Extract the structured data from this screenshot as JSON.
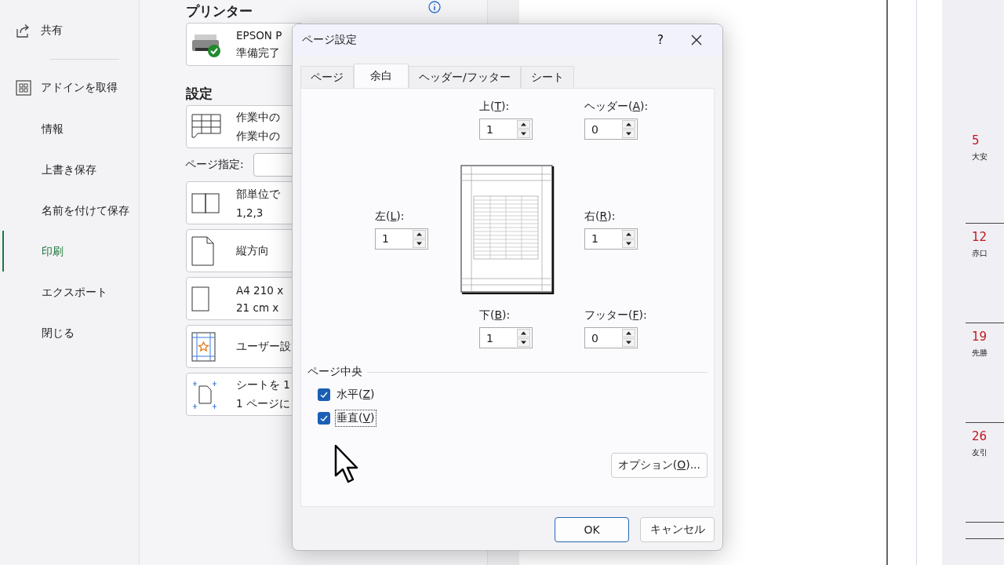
{
  "sidebar": {
    "top_items": [
      {
        "label": "共有",
        "selected": false
      },
      {
        "label": "アドインを取得",
        "selected": false
      }
    ],
    "items": [
      {
        "label": "情報",
        "selected": false
      },
      {
        "label": "上書き保存",
        "selected": false
      },
      {
        "label": "名前を付けて保存",
        "selected": false
      },
      {
        "label": "印刷",
        "selected": true
      },
      {
        "label": "エクスポート",
        "selected": false
      },
      {
        "label": "閉じる",
        "selected": false
      }
    ]
  },
  "printer": {
    "heading": "プリンター",
    "name": "EPSON P",
    "status": "準備完了",
    "ready": true
  },
  "settings": {
    "heading": "設定",
    "page_range": {
      "label": "ページ指定:"
    },
    "cards": [
      {
        "kind": "sheet",
        "lines": [
          "作業中の",
          "作業中の"
        ]
      },
      {
        "kind": "collate",
        "lines": [
          "部単位で",
          "1,2,3"
        ]
      },
      {
        "kind": "portrait",
        "lines": [
          "縦方向"
        ]
      },
      {
        "kind": "paper",
        "lines": [
          "A4 210 x",
          "21 cm x"
        ]
      },
      {
        "kind": "margins",
        "lines": [
          "ユーザー設"
        ]
      },
      {
        "kind": "scale",
        "lines": [
          "シートを 1",
          "1 ページに"
        ]
      }
    ]
  },
  "dialog": {
    "title": "ページ設定",
    "help": "?",
    "tabs": [
      {
        "label": "ページ",
        "selected": false
      },
      {
        "label": "余白",
        "selected": true
      },
      {
        "label": "ヘッダー/フッター",
        "selected": false
      },
      {
        "label": "シート",
        "selected": false
      }
    ],
    "fields": {
      "top": {
        "label": "上(",
        "key": "T",
        "suffix": "):",
        "value": "1"
      },
      "header": {
        "label": "ヘッダー(",
        "key": "A",
        "suffix": "):",
        "value": "0"
      },
      "left": {
        "label": "左(",
        "key": "L",
        "suffix": "):",
        "value": "1"
      },
      "right": {
        "label": "右(",
        "key": "R",
        "suffix": "):",
        "value": "1"
      },
      "bottom": {
        "label": "下(",
        "key": "B",
        "suffix": "):",
        "value": "1"
      },
      "footer": {
        "label": "フッター(",
        "key": "F",
        "suffix": "):",
        "value": "0"
      }
    },
    "center_group": {
      "label": "ページ中央",
      "options": [
        {
          "label": "水平(",
          "key": "Z",
          "suffix": ")",
          "checked": true,
          "focused": false
        },
        {
          "label": "垂直(",
          "key": "V",
          "suffix": ")",
          "checked": true,
          "focused": true
        }
      ]
    },
    "options_button": {
      "label": "オプション(",
      "key": "O",
      "suffix": ")..."
    },
    "buttons": [
      {
        "label": "OK",
        "default": true
      },
      {
        "label": "キャンセル",
        "default": false
      }
    ]
  },
  "calendar": {
    "days": [
      {
        "day": "5",
        "rokuyo": "大安"
      },
      {
        "day": "12",
        "rokuyo": "赤口"
      },
      {
        "day": "19",
        "rokuyo": "先勝"
      },
      {
        "day": "26",
        "rokuyo": "友引"
      }
    ]
  }
}
